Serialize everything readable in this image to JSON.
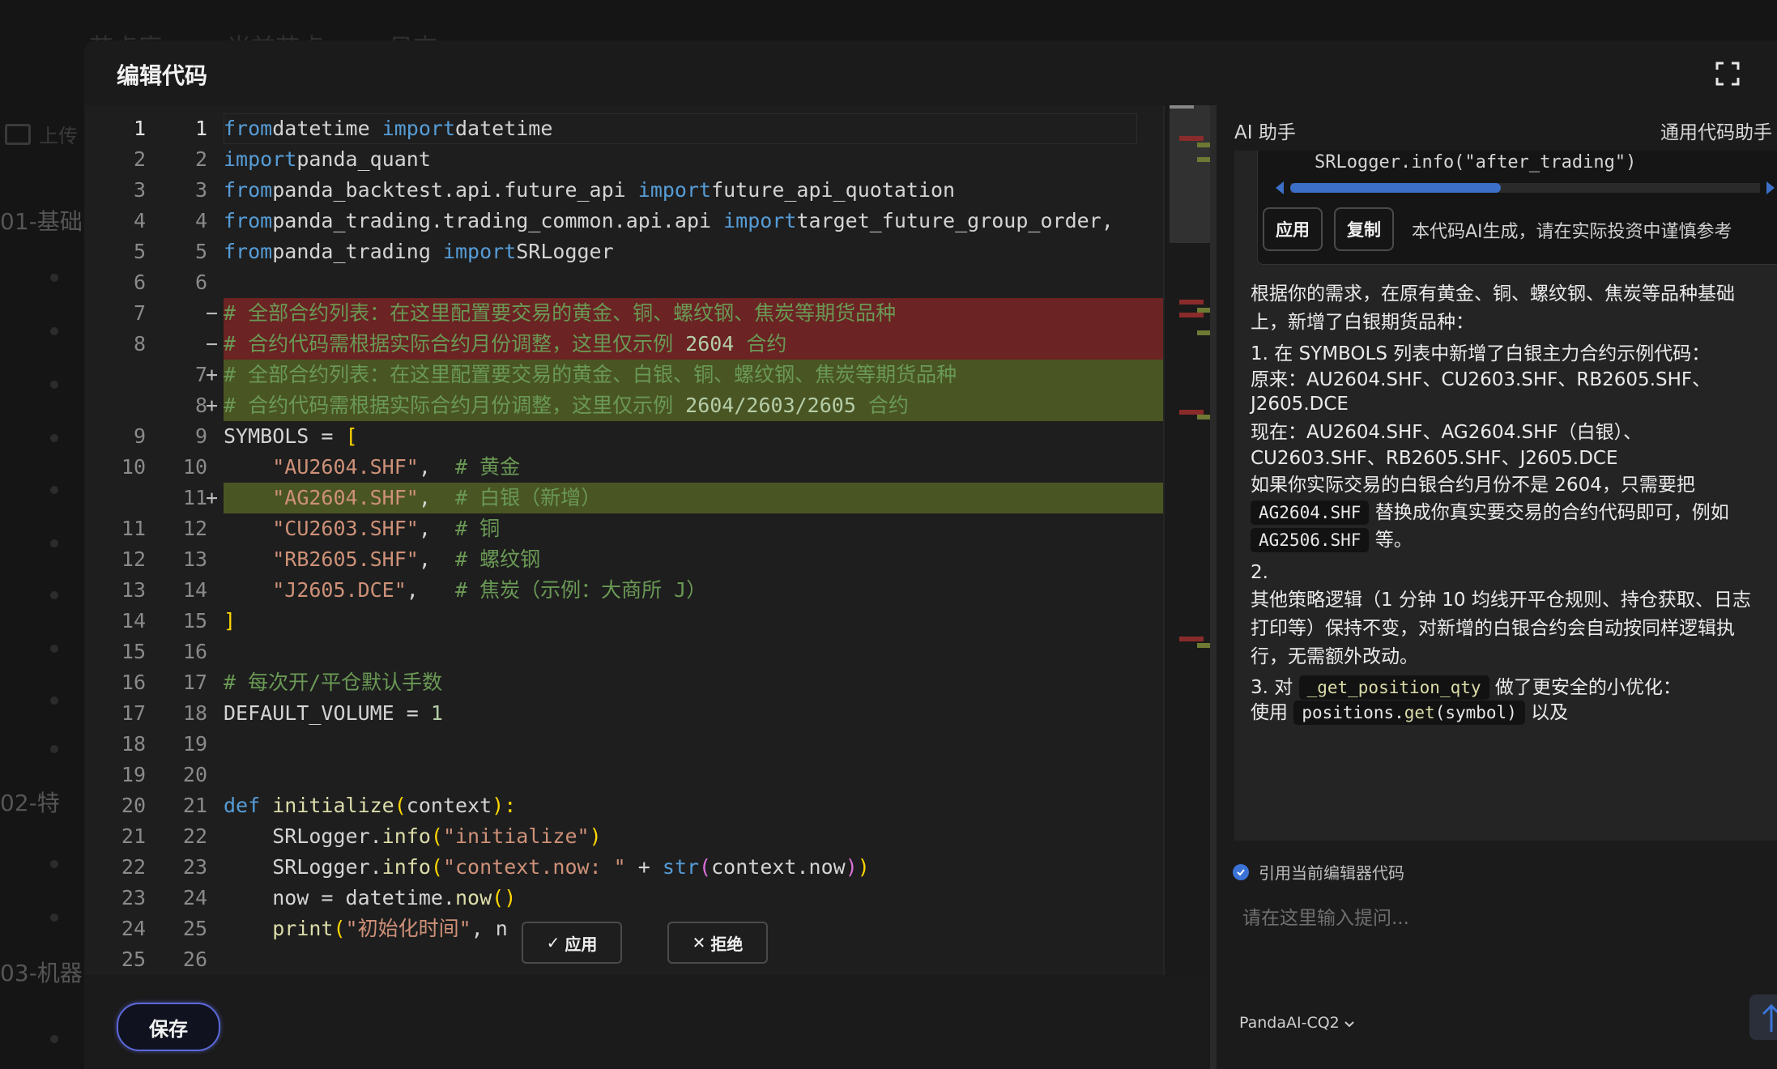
{
  "background": {
    "tabs": [
      "节点库",
      "当前节点",
      "日志"
    ],
    "upload_label": "上传",
    "groups": [
      "01-基础",
      "02-特",
      "03-机器"
    ]
  },
  "modal": {
    "title": "编辑代码",
    "save_label": "保存"
  },
  "editor": {
    "lines": [
      {
        "left": "1",
        "right": "1",
        "marker": "",
        "type": "ctx",
        "current": true
      },
      {
        "left": "2",
        "right": "2",
        "marker": "",
        "type": "ctx"
      },
      {
        "left": "3",
        "right": "3",
        "marker": "",
        "type": "ctx"
      },
      {
        "left": "4",
        "right": "4",
        "marker": "",
        "type": "ctx"
      },
      {
        "left": "5",
        "right": "5",
        "marker": "",
        "type": "ctx"
      },
      {
        "left": "6",
        "right": "6",
        "marker": "",
        "type": "ctx"
      },
      {
        "left": "7",
        "right": "",
        "marker": "−",
        "type": "del"
      },
      {
        "left": "8",
        "right": "",
        "marker": "−",
        "type": "del"
      },
      {
        "left": "",
        "right": "7",
        "marker": "+",
        "type": "add"
      },
      {
        "left": "",
        "right": "8",
        "marker": "+",
        "type": "add"
      },
      {
        "left": "9",
        "right": "9",
        "marker": "",
        "type": "ctx"
      },
      {
        "left": "10",
        "right": "10",
        "marker": "",
        "type": "ctx"
      },
      {
        "left": "",
        "right": "11",
        "marker": "+",
        "type": "add"
      },
      {
        "left": "11",
        "right": "12",
        "marker": "",
        "type": "ctx"
      },
      {
        "left": "12",
        "right": "13",
        "marker": "",
        "type": "ctx"
      },
      {
        "left": "13",
        "right": "14",
        "marker": "",
        "type": "ctx"
      },
      {
        "left": "14",
        "right": "15",
        "marker": "",
        "type": "ctx"
      },
      {
        "left": "15",
        "right": "16",
        "marker": "",
        "type": "ctx"
      },
      {
        "left": "16",
        "right": "17",
        "marker": "",
        "type": "ctx"
      },
      {
        "left": "17",
        "right": "18",
        "marker": "",
        "type": "ctx"
      },
      {
        "left": "18",
        "right": "19",
        "marker": "",
        "type": "ctx"
      },
      {
        "left": "19",
        "right": "20",
        "marker": "",
        "type": "ctx"
      },
      {
        "left": "20",
        "right": "21",
        "marker": "",
        "type": "ctx"
      },
      {
        "left": "21",
        "right": "22",
        "marker": "",
        "type": "ctx"
      },
      {
        "left": "22",
        "right": "23",
        "marker": "",
        "type": "ctx"
      },
      {
        "left": "23",
        "right": "24",
        "marker": "",
        "type": "ctx"
      },
      {
        "left": "24",
        "right": "25",
        "marker": "",
        "type": "ctx"
      },
      {
        "left": "25",
        "right": "26",
        "marker": "",
        "type": "ctx"
      }
    ],
    "code": [
      [
        [
          "kw",
          "from"
        ],
        [
          "",
          "datetime "
        ],
        [
          "kw",
          "import"
        ],
        [
          "",
          "datetime"
        ]
      ],
      [
        [
          "kw",
          "import"
        ],
        [
          "",
          "panda_quant"
        ]
      ],
      [
        [
          "kw",
          "from"
        ],
        [
          "",
          "panda_backtest.api.future_api "
        ],
        [
          "kw",
          "import"
        ],
        [
          "",
          "future_api_quotation"
        ]
      ],
      [
        [
          "kw",
          "from"
        ],
        [
          "",
          "panda_trading.trading_common.api.api "
        ],
        [
          "kw",
          "import"
        ],
        [
          "",
          "target_future_group_order,"
        ]
      ],
      [
        [
          "kw",
          "from"
        ],
        [
          "",
          "panda_trading "
        ],
        [
          "kw",
          "import"
        ],
        [
          "",
          "SRLogger"
        ]
      ],
      [],
      [
        [
          "cmt",
          "# 全部合约列表：在这里配置要交易的黄金、铜、螺纹钢、焦炭等期货品种"
        ]
      ],
      [
        [
          "cmt",
          "# 合约代码需根据实际合约月份调整，这里仅示例 "
        ],
        [
          "num",
          "2604"
        ],
        [
          "cmt",
          " 合约"
        ]
      ],
      [
        [
          "cmt",
          "# 全部合约列表：在这里配置要交易的黄金、白银、铜、螺纹钢、焦炭等期货品种"
        ]
      ],
      [
        [
          "cmt",
          "# 合约代码需根据实际合约月份调整，这里仅示例 "
        ],
        [
          "num",
          "2604/2603/2605"
        ],
        [
          "cmt",
          " 合约"
        ]
      ],
      [
        [
          "",
          "SYMBOLS = "
        ],
        [
          "br",
          "["
        ]
      ],
      [
        [
          "",
          "    "
        ],
        [
          "str",
          "\"AU2604.SHF\""
        ],
        [
          "",
          ",  "
        ],
        [
          "cmt",
          "# 黄金"
        ]
      ],
      [
        [
          "",
          "    "
        ],
        [
          "str",
          "\"AG2604.SHF\""
        ],
        [
          "",
          ",  "
        ],
        [
          "cmt",
          "# 白银（新增）"
        ]
      ],
      [
        [
          "",
          "    "
        ],
        [
          "str",
          "\"CU2603.SHF\""
        ],
        [
          "",
          ",  "
        ],
        [
          "cmt",
          "# 铜"
        ]
      ],
      [
        [
          "",
          "    "
        ],
        [
          "str",
          "\"RB2605.SHF\""
        ],
        [
          "",
          ",  "
        ],
        [
          "cmt",
          "# 螺纹钢"
        ]
      ],
      [
        [
          "",
          "    "
        ],
        [
          "str",
          "\"J2605.DCE\""
        ],
        [
          "",
          ",   "
        ],
        [
          "cmt",
          "# 焦炭（示例：大商所 J）"
        ]
      ],
      [
        [
          "br",
          "]"
        ]
      ],
      [],
      [
        [
          "cmt",
          "# 每次开/平仓默认手数"
        ]
      ],
      [
        [
          "",
          "DEFAULT_VOLUME = "
        ],
        [
          "num",
          "1"
        ]
      ],
      [],
      [],
      [
        [
          "kw",
          "def "
        ],
        [
          "fn",
          "initialize"
        ],
        [
          "br",
          "("
        ],
        [
          "",
          "context"
        ],
        [
          "br",
          "):"
        ]
      ],
      [
        [
          "",
          "    SRLogger."
        ],
        [
          "fn",
          "info"
        ],
        [
          "br",
          "("
        ],
        [
          "str",
          "\"initialize\""
        ],
        [
          "br",
          ")"
        ]
      ],
      [
        [
          "",
          "    SRLogger."
        ],
        [
          "fn",
          "info"
        ],
        [
          "br",
          "("
        ],
        [
          "str",
          "\"context.now: \""
        ],
        [
          "",
          " + "
        ],
        [
          "kw",
          "str"
        ],
        [
          "br2",
          "("
        ],
        [
          "",
          "context.now"
        ],
        [
          "br2",
          ")"
        ],
        [
          "br",
          ")"
        ]
      ],
      [
        [
          "",
          "    now = datetime."
        ],
        [
          "fn",
          "now"
        ],
        [
          "br",
          "()"
        ]
      ],
      [
        [
          "",
          "    "
        ],
        [
          "fn",
          "print"
        ],
        [
          "br",
          "("
        ],
        [
          "str",
          "\"初始化时间\""
        ],
        [
          "",
          ", n"
        ]
      ],
      []
    ],
    "inline_apply": "应用",
    "inline_reject": "拒绝"
  },
  "ai": {
    "title": "AI 助手",
    "mode": "通用代码助手",
    "snippet": "SRLogger.info(\"after_trading\")",
    "apply_label": "应用",
    "copy_label": "复制",
    "disclaimer": "本代码AI生成，请在实际投资中谨慎参考",
    "intro": "根据你的需求，在原有黄金、铜、螺纹钢、焦炭等品种基础上，新增了白银期货品种：",
    "p1_title": "1. 在 SYMBOLS 列表中新增了白银主力合约示例代码：",
    "p1_old": "原来：AU2604.SHF、CU2603.SHF、RB2605.SHF、J2605.DCE",
    "p1_new": "现在：AU2604.SHF、AG2604.SHF（白银）、CU2603.SHF、RB2605.SHF、J2605.DCE",
    "p1_note_a": "如果你实际交易的白银合约月份不是 2604，只需要把",
    "p1_code_a": "AG2604.SHF",
    "p1_note_b": "替换成你真实要交易的合约代码即可，例如",
    "p1_code_b": "AG2506.SHF",
    "p1_note_c": "等。",
    "p2_num": "2.",
    "p2_text": "其他策略逻辑（1 分钟 10 均线开平仓规则、持仓获取、日志打印等）保持不变，对新增的白银合约会自动按同样逻辑执行，无需额外改动。",
    "p3_a": "3. 对",
    "p3_code": "_get_position_qty",
    "p3_b": "做了更安全的小优化：",
    "p3_use": "使用",
    "p3_code2_obj": "positions.",
    "p3_code2_fn": "get",
    "p3_code2_arg": "(symbol)",
    "p3_tail": "以及",
    "ref_label": "引用当前编辑器代码",
    "placeholder": "请在这里输入提问...",
    "model": "PandaAI-CQ2"
  },
  "colors": {
    "accent": "#5b68d9",
    "del_bg": "#6b2323",
    "add_bg": "#4a5524",
    "keyword": "#569cd6",
    "comment": "#6a9955",
    "string": "#ce9178"
  }
}
